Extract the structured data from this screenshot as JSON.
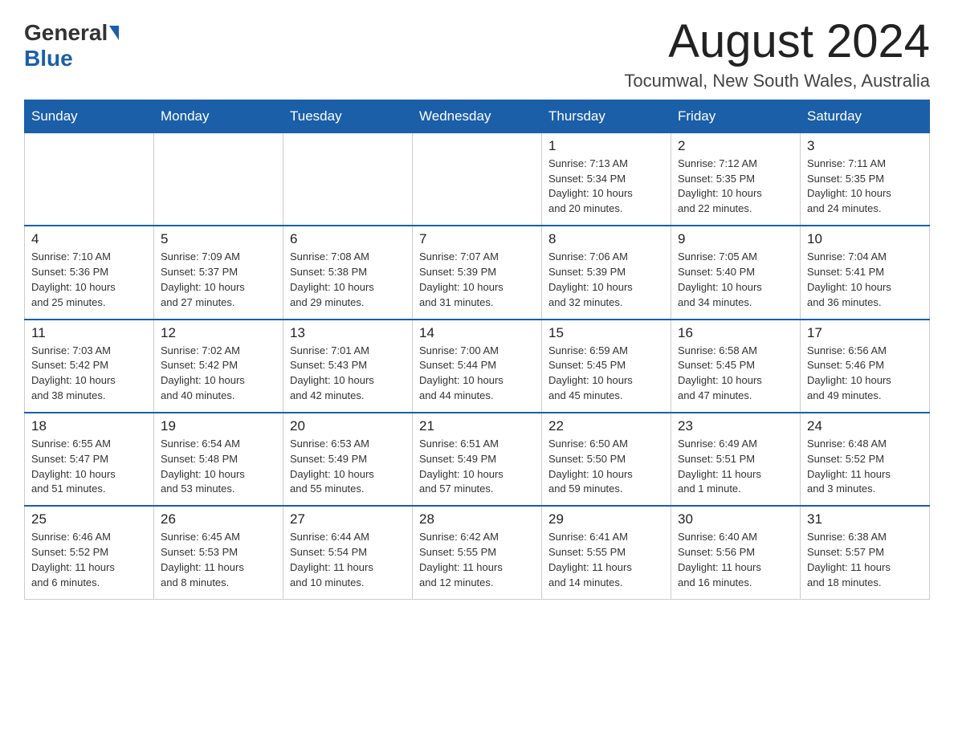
{
  "header": {
    "logo_general": "General",
    "logo_blue": "Blue",
    "month_title": "August 2024",
    "location": "Tocumwal, New South Wales, Australia"
  },
  "days_of_week": [
    "Sunday",
    "Monday",
    "Tuesday",
    "Wednesday",
    "Thursday",
    "Friday",
    "Saturday"
  ],
  "weeks": [
    [
      {
        "day": "",
        "info": ""
      },
      {
        "day": "",
        "info": ""
      },
      {
        "day": "",
        "info": ""
      },
      {
        "day": "",
        "info": ""
      },
      {
        "day": "1",
        "info": "Sunrise: 7:13 AM\nSunset: 5:34 PM\nDaylight: 10 hours\nand 20 minutes."
      },
      {
        "day": "2",
        "info": "Sunrise: 7:12 AM\nSunset: 5:35 PM\nDaylight: 10 hours\nand 22 minutes."
      },
      {
        "day": "3",
        "info": "Sunrise: 7:11 AM\nSunset: 5:35 PM\nDaylight: 10 hours\nand 24 minutes."
      }
    ],
    [
      {
        "day": "4",
        "info": "Sunrise: 7:10 AM\nSunset: 5:36 PM\nDaylight: 10 hours\nand 25 minutes."
      },
      {
        "day": "5",
        "info": "Sunrise: 7:09 AM\nSunset: 5:37 PM\nDaylight: 10 hours\nand 27 minutes."
      },
      {
        "day": "6",
        "info": "Sunrise: 7:08 AM\nSunset: 5:38 PM\nDaylight: 10 hours\nand 29 minutes."
      },
      {
        "day": "7",
        "info": "Sunrise: 7:07 AM\nSunset: 5:39 PM\nDaylight: 10 hours\nand 31 minutes."
      },
      {
        "day": "8",
        "info": "Sunrise: 7:06 AM\nSunset: 5:39 PM\nDaylight: 10 hours\nand 32 minutes."
      },
      {
        "day": "9",
        "info": "Sunrise: 7:05 AM\nSunset: 5:40 PM\nDaylight: 10 hours\nand 34 minutes."
      },
      {
        "day": "10",
        "info": "Sunrise: 7:04 AM\nSunset: 5:41 PM\nDaylight: 10 hours\nand 36 minutes."
      }
    ],
    [
      {
        "day": "11",
        "info": "Sunrise: 7:03 AM\nSunset: 5:42 PM\nDaylight: 10 hours\nand 38 minutes."
      },
      {
        "day": "12",
        "info": "Sunrise: 7:02 AM\nSunset: 5:42 PM\nDaylight: 10 hours\nand 40 minutes."
      },
      {
        "day": "13",
        "info": "Sunrise: 7:01 AM\nSunset: 5:43 PM\nDaylight: 10 hours\nand 42 minutes."
      },
      {
        "day": "14",
        "info": "Sunrise: 7:00 AM\nSunset: 5:44 PM\nDaylight: 10 hours\nand 44 minutes."
      },
      {
        "day": "15",
        "info": "Sunrise: 6:59 AM\nSunset: 5:45 PM\nDaylight: 10 hours\nand 45 minutes."
      },
      {
        "day": "16",
        "info": "Sunrise: 6:58 AM\nSunset: 5:45 PM\nDaylight: 10 hours\nand 47 minutes."
      },
      {
        "day": "17",
        "info": "Sunrise: 6:56 AM\nSunset: 5:46 PM\nDaylight: 10 hours\nand 49 minutes."
      }
    ],
    [
      {
        "day": "18",
        "info": "Sunrise: 6:55 AM\nSunset: 5:47 PM\nDaylight: 10 hours\nand 51 minutes."
      },
      {
        "day": "19",
        "info": "Sunrise: 6:54 AM\nSunset: 5:48 PM\nDaylight: 10 hours\nand 53 minutes."
      },
      {
        "day": "20",
        "info": "Sunrise: 6:53 AM\nSunset: 5:49 PM\nDaylight: 10 hours\nand 55 minutes."
      },
      {
        "day": "21",
        "info": "Sunrise: 6:51 AM\nSunset: 5:49 PM\nDaylight: 10 hours\nand 57 minutes."
      },
      {
        "day": "22",
        "info": "Sunrise: 6:50 AM\nSunset: 5:50 PM\nDaylight: 10 hours\nand 59 minutes."
      },
      {
        "day": "23",
        "info": "Sunrise: 6:49 AM\nSunset: 5:51 PM\nDaylight: 11 hours\nand 1 minute."
      },
      {
        "day": "24",
        "info": "Sunrise: 6:48 AM\nSunset: 5:52 PM\nDaylight: 11 hours\nand 3 minutes."
      }
    ],
    [
      {
        "day": "25",
        "info": "Sunrise: 6:46 AM\nSunset: 5:52 PM\nDaylight: 11 hours\nand 6 minutes."
      },
      {
        "day": "26",
        "info": "Sunrise: 6:45 AM\nSunset: 5:53 PM\nDaylight: 11 hours\nand 8 minutes."
      },
      {
        "day": "27",
        "info": "Sunrise: 6:44 AM\nSunset: 5:54 PM\nDaylight: 11 hours\nand 10 minutes."
      },
      {
        "day": "28",
        "info": "Sunrise: 6:42 AM\nSunset: 5:55 PM\nDaylight: 11 hours\nand 12 minutes."
      },
      {
        "day": "29",
        "info": "Sunrise: 6:41 AM\nSunset: 5:55 PM\nDaylight: 11 hours\nand 14 minutes."
      },
      {
        "day": "30",
        "info": "Sunrise: 6:40 AM\nSunset: 5:56 PM\nDaylight: 11 hours\nand 16 minutes."
      },
      {
        "day": "31",
        "info": "Sunrise: 6:38 AM\nSunset: 5:57 PM\nDaylight: 11 hours\nand 18 minutes."
      }
    ]
  ]
}
